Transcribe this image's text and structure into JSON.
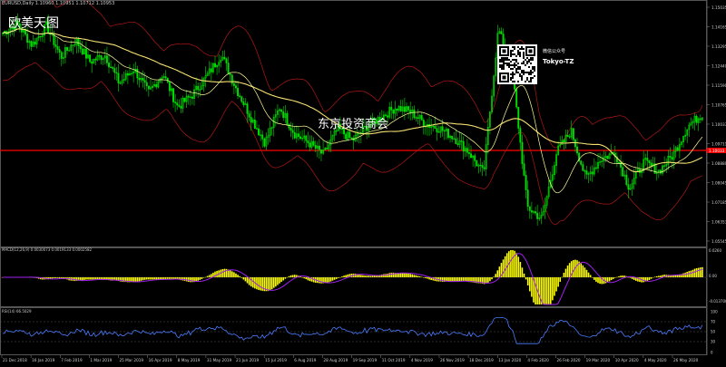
{
  "header": {
    "symbol_line": "EURUSD,Daily  1.10960 1.10951 1.10712 1.10953"
  },
  "overlays": {
    "title_cn": "欧美天图",
    "watermark_cn": "东京投资商会",
    "wechat_label": "微信公众号",
    "wechat_id": "Tokyo-TZ"
  },
  "price_axis": {
    "labels": [
      "1.15035",
      "1.14165",
      "1.13295",
      "1.12440",
      "1.11590",
      "1.10765",
      "1.10033",
      "1.09711",
      "1.08880",
      "1.08045",
      "1.07185",
      "1.06353",
      "1.05545"
    ],
    "current_price": "1.10033"
  },
  "macd_panel": {
    "title": "MACD(12,26,9) 0.0030073 0.0019133 0.0002582",
    "axis_labels": [
      "0.0260",
      "0.00",
      "-0.013700"
    ]
  },
  "rsi_panel": {
    "title": "RSI(14) 66.5029",
    "axis_labels": [
      "100",
      "70",
      "50",
      "30",
      "0"
    ]
  },
  "time_axis": {
    "labels": [
      "21 Dec 2018",
      "16 Jan 2019",
      "7 Feb 2019",
      "1 Mar 2019",
      "25 Mar 2019",
      "16 Apr 2019",
      "8 May 2019",
      "31 May 2019",
      "21 Jun 2019",
      "15 Jul 2019",
      "6 Aug 2019",
      "28 Aug 2019",
      "19 Sep 2019",
      "11 Oct 2019",
      "4 Nov 2019",
      "26 Nov 2019",
      "18 Dec 2019",
      "13 Jan 2020",
      "4 Feb 2020",
      "26 Feb 2020",
      "19 Mar 2020",
      "10 Apr 2020",
      "4 May 2020",
      "26 May 2020"
    ]
  },
  "colors": {
    "background": "#000000",
    "bull_candle": "#00e000",
    "bear_candle": "#00e000",
    "ma_fast": "#ffff99",
    "ma_slow": "#f5e070",
    "envelope": "#b01818",
    "price_line": "#ff0000",
    "macd_hist": "#ffff00",
    "macd_signal": "#a020f0",
    "rsi_line": "#4a7cff"
  },
  "chart_data": {
    "type": "line",
    "title": "EURUSD,Daily",
    "ylim": [
      1.055,
      1.155
    ],
    "series": [
      {
        "name": "EURUSD",
        "values": [
          1.143,
          1.147,
          1.138,
          1.146,
          1.133,
          1.14,
          1.131,
          1.134,
          1.122,
          1.128,
          1.118,
          1.126,
          1.112,
          1.117,
          1.125,
          1.134,
          1.12,
          1.108,
          1.097,
          1.112,
          1.101,
          1.097,
          1.092,
          1.103,
          1.098,
          1.104,
          1.108,
          1.112,
          1.11,
          1.105,
          1.103,
          1.099,
          1.093,
          1.084,
          1.145,
          1.125,
          1.07,
          1.065,
          1.093,
          1.102,
          1.082,
          1.09,
          1.093,
          1.078,
          1.089,
          1.085,
          1.092,
          1.104,
          1.109
        ]
      }
    ]
  }
}
